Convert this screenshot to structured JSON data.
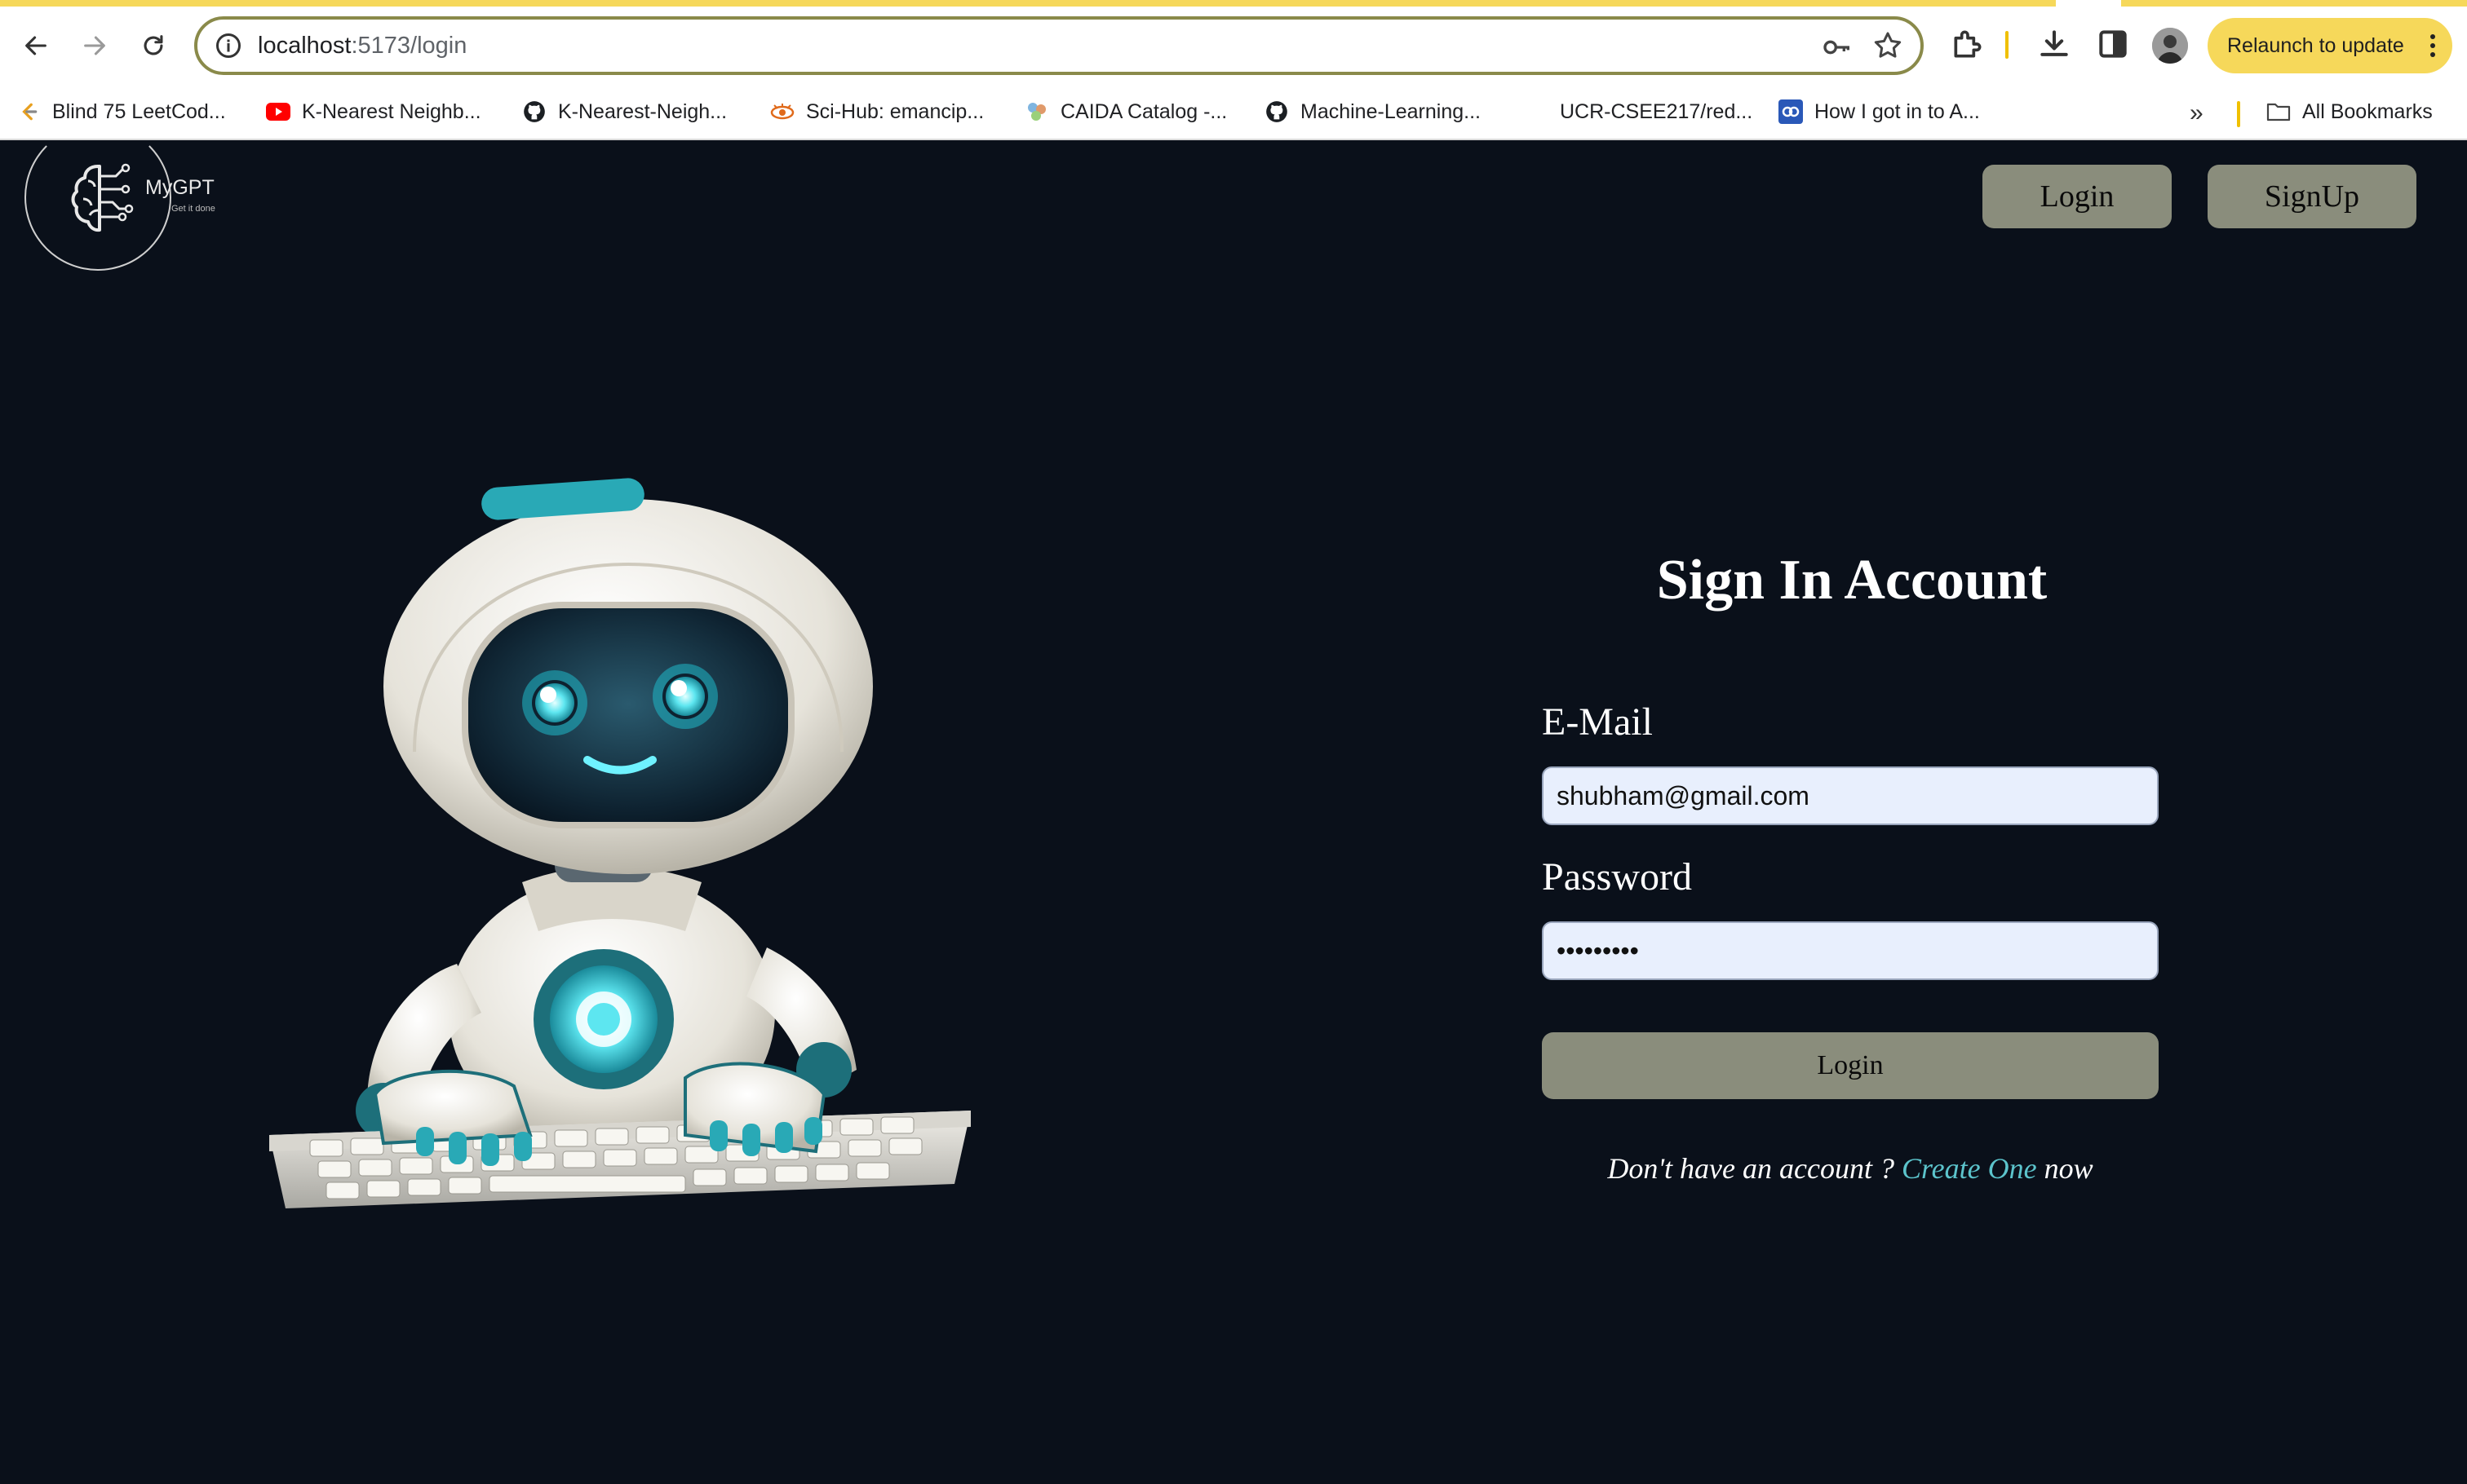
{
  "browser": {
    "url_host": "localhost",
    "url_path": ":5173/login",
    "relaunch_label": "Relaunch to update",
    "bookmarks": [
      {
        "label": "Blind 75 LeetCod...",
        "icon": "leetcode-icon"
      },
      {
        "label": "K-Nearest Neighb...",
        "icon": "youtube-icon"
      },
      {
        "label": "K-Nearest-Neigh...",
        "icon": "github-icon"
      },
      {
        "label": "Sci-Hub: emancip...",
        "icon": "scihub-icon"
      },
      {
        "label": "CAIDA Catalog -...",
        "icon": "caida-icon"
      },
      {
        "label": "Machine-Learning...",
        "icon": "github-icon"
      },
      {
        "label": "UCR-CSEE217/red...",
        "icon": "blank-icon"
      },
      {
        "label": "How I got in to A...",
        "icon": "coursera-icon"
      }
    ],
    "more_bookmarks": "»",
    "all_bookmarks_label": "All Bookmarks"
  },
  "header": {
    "logo_text": "MyGPT",
    "logo_tagline": "Get it done",
    "login_label": "Login",
    "signup_label": "SignUp"
  },
  "form": {
    "title": "Sign In Account",
    "email_label": "E-Mail",
    "email_value": "shubham@gmail.com",
    "password_label": "Password",
    "password_value": "•••••••••",
    "submit_label": "Login",
    "prompt_prefix": "Don't have an account ?",
    "create_link": "Create One",
    "prompt_suffix": "now"
  },
  "colors": {
    "background": "#0a101a",
    "button": "#8a8d7c",
    "input_bg": "#e8effd",
    "link": "#5cc4cc",
    "relaunch": "#f6d85a"
  }
}
